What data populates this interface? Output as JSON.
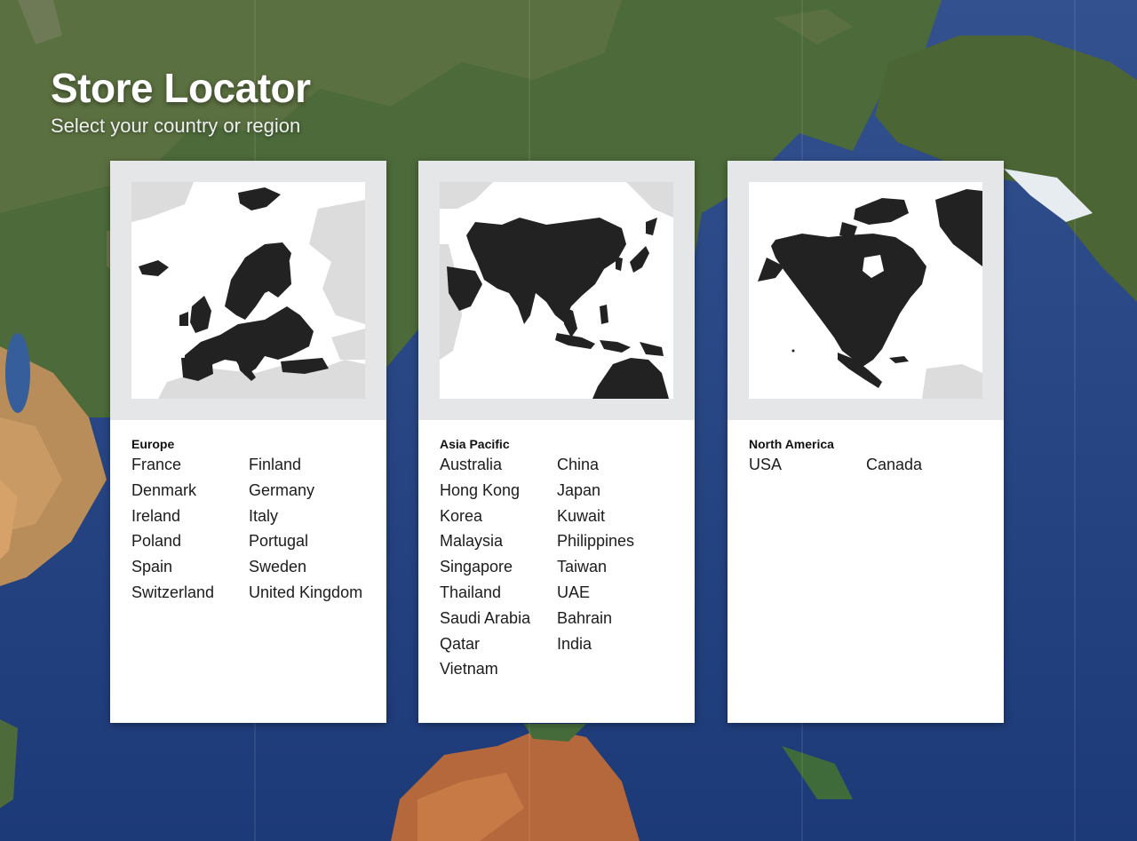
{
  "header": {
    "title": "Store Locator",
    "subtitle": "Select your country or region"
  },
  "regions": [
    {
      "name": "Europe",
      "map_icon": "europe-map-icon",
      "countries": [
        "France",
        "Finland",
        "Denmark",
        "Germany",
        "Ireland",
        "Italy",
        "Poland",
        "Portugal",
        "Spain",
        "Sweden",
        "Switzerland",
        "United Kingdom"
      ]
    },
    {
      "name": "Asia Pacific",
      "map_icon": "asia-pacific-map-icon",
      "countries": [
        "Australia",
        "China",
        "Hong Kong",
        "Japan",
        "Korea",
        "Kuwait",
        "Malaysia",
        "Philippines",
        "Singapore",
        "Taiwan",
        "Thailand",
        "UAE",
        "Saudi Arabia",
        "Bahrain",
        "Qatar",
        "India",
        "Vietnam"
      ]
    },
    {
      "name": "North America",
      "map_icon": "north-america-map-icon",
      "countries": [
        "USA",
        "Canada"
      ]
    }
  ],
  "colors": {
    "land_dark": "#222222",
    "land_light": "#dcdcdc",
    "card_background": "#ffffff",
    "card_top_background": "#e2e4e6"
  }
}
